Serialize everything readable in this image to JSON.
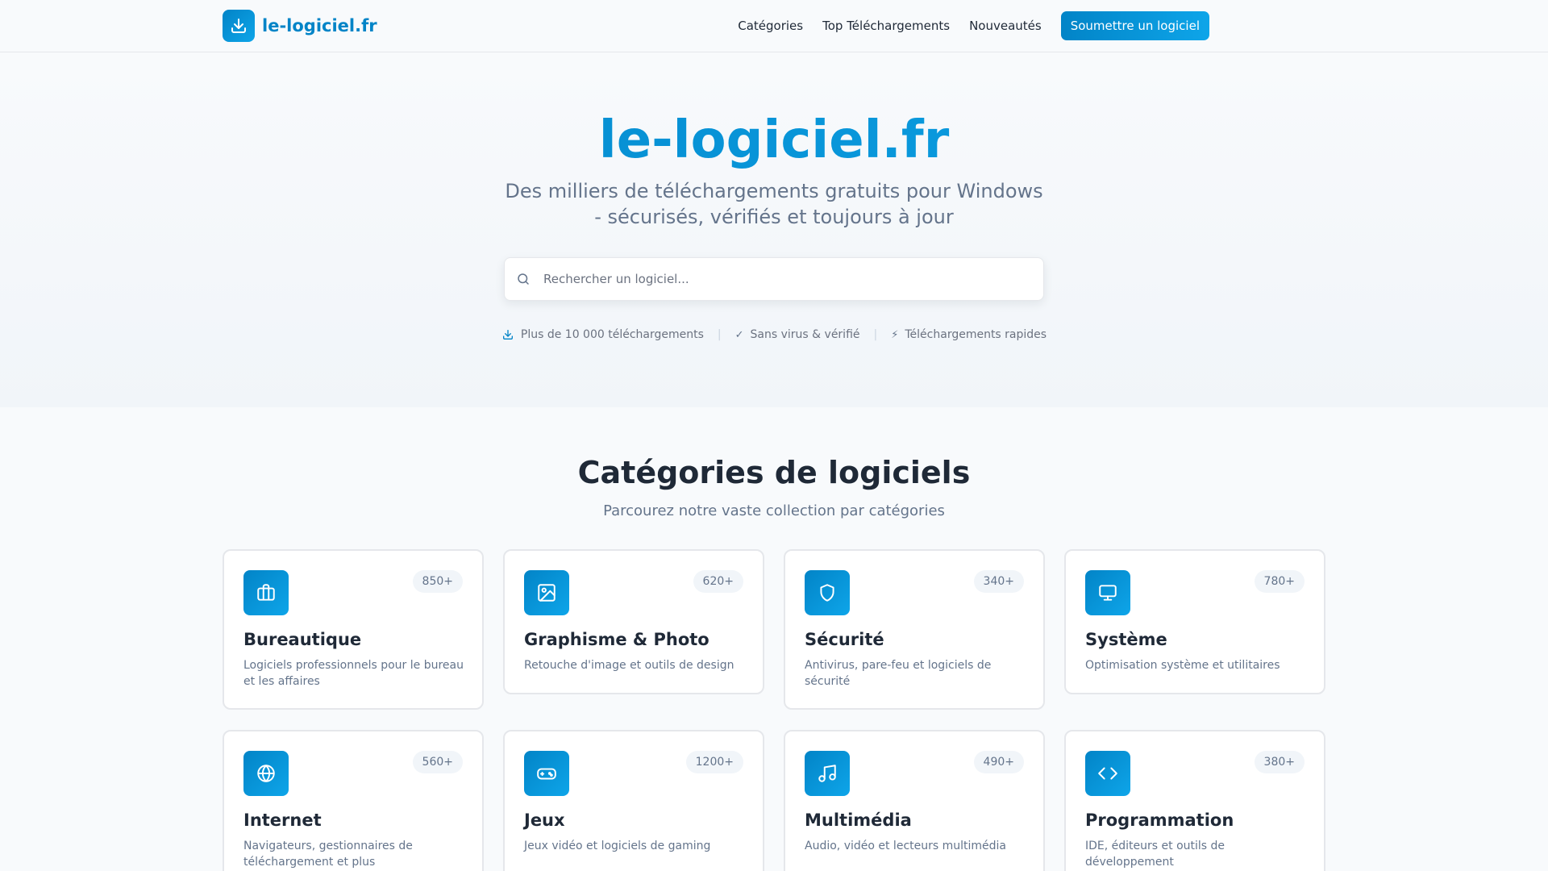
{
  "header": {
    "logo_text": "le-logiciel.fr",
    "nav": [
      "Catégories",
      "Top Téléchargements",
      "Nouveautés"
    ],
    "submit_label": "Soumettre un logiciel"
  },
  "hero": {
    "title": "le-logiciel.fr",
    "subtitle": "Des milliers de téléchargements gratuits pour Windows - sécurisés, vérifiés et toujours à jour",
    "search_placeholder": "Rechercher un logiciel...",
    "features": [
      "Plus de 10 000 téléchargements",
      "Sans virus & vérifié",
      "Téléchargements rapides"
    ],
    "feature_glyphs": [
      "download-icon",
      "✓",
      "⚡"
    ]
  },
  "categories": {
    "title": "Catégories de logiciels",
    "subtitle": "Parcourez notre vaste collection par catégories",
    "items": [
      {
        "name": "Bureautique",
        "count": "850+",
        "desc": "Logiciels professionnels pour le bureau et les affaires",
        "icon": "briefcase-icon"
      },
      {
        "name": "Graphisme & Photo",
        "count": "620+",
        "desc": "Retouche d'image et outils de design",
        "icon": "image-icon"
      },
      {
        "name": "Sécurité",
        "count": "340+",
        "desc": "Antivirus, pare-feu et logiciels de sécurité",
        "icon": "shield-icon"
      },
      {
        "name": "Système",
        "count": "780+",
        "desc": "Optimisation système et utilitaires",
        "icon": "monitor-icon"
      },
      {
        "name": "Internet",
        "count": "560+",
        "desc": "Navigateurs, gestionnaires de téléchargement et plus",
        "icon": "globe-icon"
      },
      {
        "name": "Jeux",
        "count": "1200+",
        "desc": "Jeux vidéo et logiciels de gaming",
        "icon": "gamepad-icon"
      },
      {
        "name": "Multimédia",
        "count": "490+",
        "desc": "Audio, vidéo et lecteurs multimédia",
        "icon": "music-icon"
      },
      {
        "name": "Programmation",
        "count": "380+",
        "desc": "IDE, éditeurs et outils de développement",
        "icon": "code-icon"
      }
    ]
  },
  "colors": {
    "accent": "#0ea5e9",
    "accent_dark": "#0284c7",
    "text": "#1f2937",
    "muted": "#64748b"
  }
}
